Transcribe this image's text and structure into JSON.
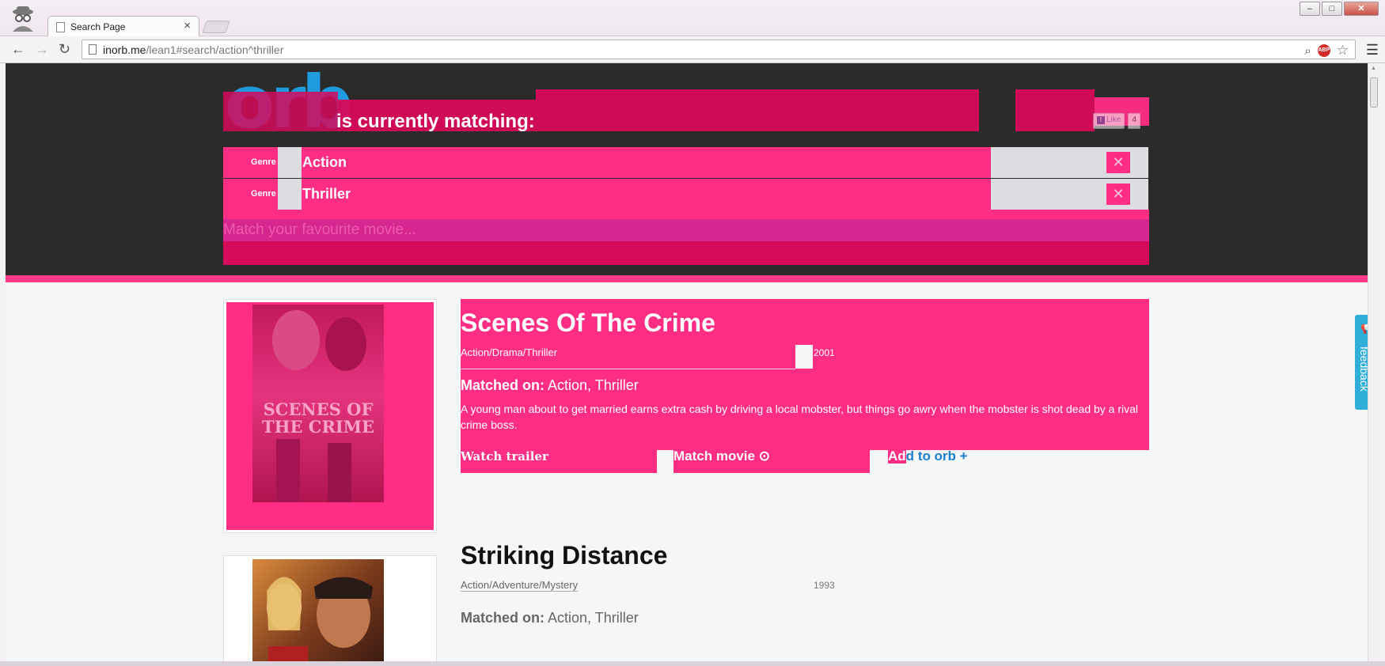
{
  "browser": {
    "tab_title": "Search Page",
    "tab_close": "×",
    "url_host": "inorb.me",
    "url_path": "/lean1#search/action^thriller",
    "window_controls": [
      "–",
      "□",
      "✕"
    ],
    "abp_label": "ABP"
  },
  "header": {
    "logo": "orb",
    "matching_label": "is currently matching:",
    "fb_like": {
      "label": "Like",
      "count": "4"
    },
    "genres": [
      {
        "type": "Genre",
        "name": "Action",
        "remove": "✕"
      },
      {
        "type": "Genre",
        "name": "Thriller",
        "remove": "✕"
      }
    ],
    "search_placeholder": "Match your favourite movie..."
  },
  "results": [
    {
      "title": "Scenes Of The Crime",
      "genres": "Action/Drama/Thriller",
      "year": "2001",
      "matched_label": "Matched on:",
      "matched_values": "Action, Thriller",
      "synopsis": "A young man about to get married earns extra cash by driving a local mobster, but things go awry when the mobster is shot dead by a rival crime boss.",
      "buttons": {
        "trailer": "Watch trailer",
        "match": "Match movie ⊙",
        "add_prefix": "Ad",
        "add_rest": "d to orb +"
      },
      "poster_text": "SCENES OF THE CRIME"
    },
    {
      "title": "Striking Distance",
      "genres": "Action/Adventure/Mystery",
      "year": "1993",
      "matched_label": "Matched on:",
      "matched_values": "Action, Thriller"
    }
  ],
  "feedback": {
    "label": "feedback"
  },
  "colors": {
    "pink": "#ff2d84",
    "dark_pink": "#d60a5b",
    "header_bg": "#2c2b2c",
    "orb_blue": "#1f9be0"
  }
}
